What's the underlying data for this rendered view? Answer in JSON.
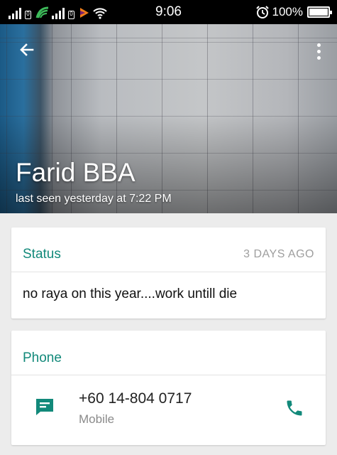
{
  "status_bar": {
    "time": "9:06",
    "battery": "100%",
    "battery_level": 1.0,
    "sim1_badge": "0",
    "sim2_badge": "0"
  },
  "header": {
    "contact_name": "Farid BBA",
    "last_seen": "last seen yesterday at 7:22 PM"
  },
  "status_card": {
    "title": "Status",
    "time_ago": "3 DAYS AGO",
    "text": "no raya on this year....work untill die"
  },
  "phone_card": {
    "title": "Phone",
    "number": "+60 14-804 0717",
    "type": "Mobile"
  },
  "colors": {
    "accent": "#12897a",
    "secondary_text": "#9e9e9e"
  }
}
